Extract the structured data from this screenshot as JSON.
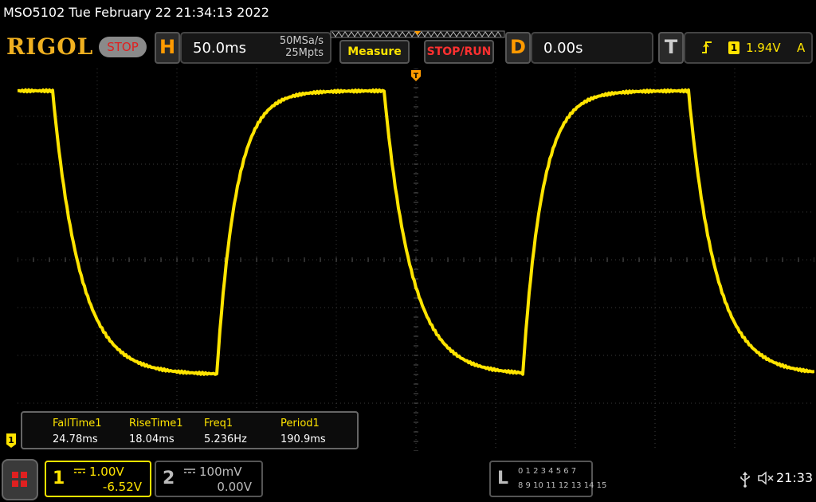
{
  "title_bar": {
    "text": "MSO5102  Tue February 22 21:34:13 2022"
  },
  "header": {
    "logo": "RIGOL",
    "stop_label": "STOP",
    "horizontal": {
      "letter": "H",
      "timebase": "50.0ms",
      "sample_rate": "50MSa/s",
      "memory_depth": "25Mpts"
    },
    "measure_label": "Measure",
    "stop_run_label": "STOP/RUN",
    "delay": {
      "letter": "D",
      "value": "0.00s"
    },
    "trigger": {
      "letter": "T",
      "slope_icon": "rising-edge-icon",
      "channel": "1",
      "level": "1.94V",
      "mode": "A"
    }
  },
  "colors": {
    "trace": "#ffe400",
    "grid": "#3a3a3a",
    "accent": "#ff9a00",
    "stop": "#e02020"
  },
  "measurements": [
    {
      "label": "FallTime1",
      "value": "24.78ms"
    },
    {
      "label": "RiseTime1",
      "value": "18.04ms"
    },
    {
      "label": "Freq1",
      "value": "5.236Hz"
    },
    {
      "label": "Period1",
      "value": "190.9ms"
    }
  ],
  "channel_marker": "1",
  "channels": [
    {
      "number": "1",
      "scale": "1.00V",
      "offset": "-6.52V"
    },
    {
      "number": "2",
      "scale": "100mV",
      "offset": "0.00V"
    }
  ],
  "logic_analyzer": {
    "letter": "L",
    "row1": "0 1 2 3  4 5 6 7",
    "row2": "8 9 10 11 12 13 14 15"
  },
  "status": {
    "usb_icon": "usb-icon",
    "sound_icon": "mute-icon",
    "time": "21:33"
  }
}
